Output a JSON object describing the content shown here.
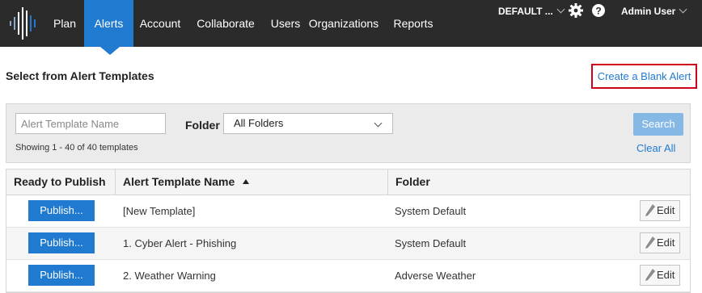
{
  "nav": {
    "items": [
      {
        "label": "Plan"
      },
      {
        "label": "Alerts"
      },
      {
        "label": "Account"
      },
      {
        "label": "Collaborate"
      },
      {
        "label": "Users"
      },
      {
        "label": "Organizations"
      },
      {
        "label": "Reports"
      }
    ],
    "active": "Alerts",
    "account_menu": "DEFAULT ...",
    "user_menu": "Admin User"
  },
  "icons": {
    "logo": "waveform-logo-icon",
    "settings": "gear-icon",
    "help": "help-icon",
    "dropdown": "chevron-down-icon",
    "sort": "sort-ascending-icon",
    "edit": "pencil-icon"
  },
  "page": {
    "title": "Select from Alert Templates",
    "create_blank_label": "Create a Blank Alert"
  },
  "filters": {
    "search_placeholder": "Alert Template Name",
    "search_value": "",
    "folder_label": "Folder",
    "folder_selected": "All Folders",
    "showing_text": "Showing 1 - 40 of 40 templates",
    "search_button": "Search",
    "clear_all": "Clear All"
  },
  "table": {
    "columns": [
      "Ready to Publish",
      "Alert Template Name",
      "Folder"
    ],
    "sorted_column": "Alert Template Name",
    "sort_direction": "ascending",
    "publish_label": "Publish...",
    "edit_label": "Edit",
    "rows": [
      {
        "name": "[New Template]",
        "folder": "System Default"
      },
      {
        "name": "1. Cyber Alert - Phishing",
        "folder": "System Default"
      },
      {
        "name": "2. Weather Warning",
        "folder": "Adverse Weather"
      }
    ]
  },
  "colors": {
    "topbar": "#2b2b2b",
    "accent": "#1f7ad0",
    "highlight_border": "#d0021b",
    "search_button_disabled": "#86b8e6"
  }
}
